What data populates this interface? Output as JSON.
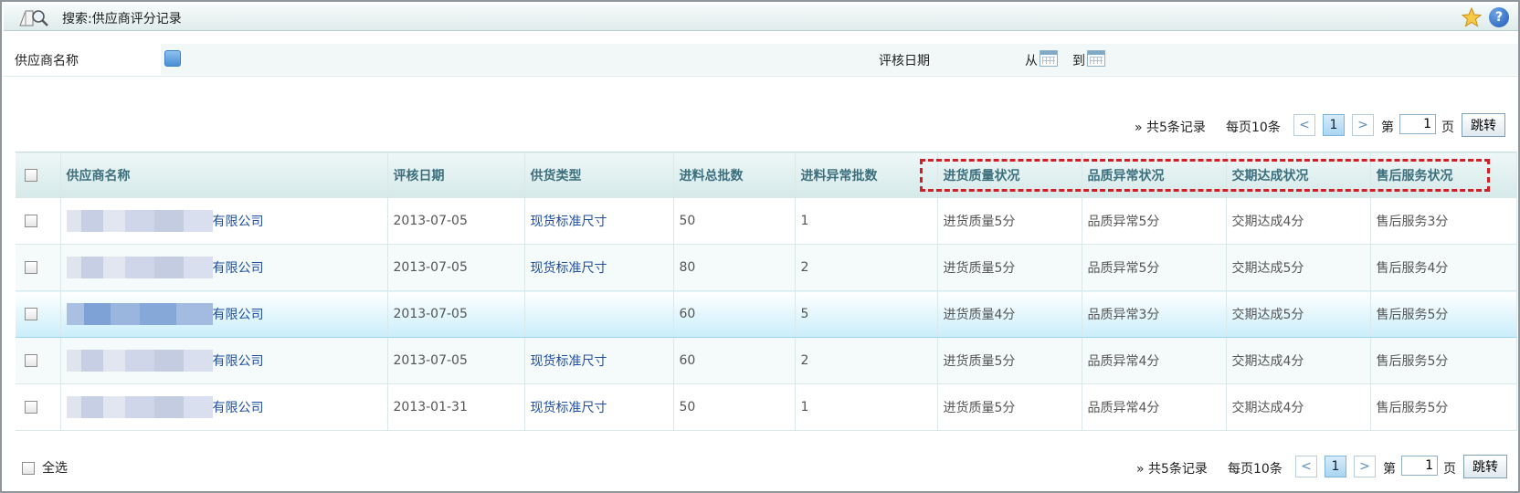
{
  "header": {
    "title": "搜索:供应商评分记录",
    "icons": [
      "search-doc-icon",
      "star-icon",
      "help-icon"
    ],
    "help_glyph": "?"
  },
  "search": {
    "supplier_label": "供应商名称",
    "supplier_value": "",
    "date_label": "评核日期",
    "from_label": "从",
    "to_label": "到"
  },
  "pager": {
    "total_text": "» 共5条记录",
    "per_page_text": "每页10条",
    "prev": "<",
    "next": ">",
    "current_page": "1",
    "page_prefix": "第",
    "page_suffix": "页",
    "page_input": "1",
    "jump_label": "跳转"
  },
  "table": {
    "columns": [
      "供应商名称",
      "评核日期",
      "供货类型",
      "进料总批数",
      "进料异常批数",
      "进货质量状况",
      "品质异常状况",
      "交期达成状况",
      "售后服务状况"
    ],
    "rows": [
      {
        "company_suffix": "有限公司",
        "date": "2013-07-05",
        "supply_type": "现货标准尺寸",
        "total": "50",
        "abnormal": "1",
        "quality": "进货质量5分",
        "defect": "品质异常5分",
        "delivery": "交期达成4分",
        "service": "售后服务3分"
      },
      {
        "company_suffix": "有限公司",
        "date": "2013-07-05",
        "supply_type": "现货标准尺寸",
        "total": "80",
        "abnormal": "2",
        "quality": "进货质量5分",
        "defect": "品质异常5分",
        "delivery": "交期达成5分",
        "service": "售后服务4分"
      },
      {
        "company_suffix": "有限公司",
        "date": "2013-07-05",
        "supply_type": "",
        "total": "60",
        "abnormal": "5",
        "quality": "进货质量4分",
        "defect": "品质异常3分",
        "delivery": "交期达成5分",
        "service": "售后服务5分"
      },
      {
        "company_suffix": "有限公司",
        "date": "2013-07-05",
        "supply_type": "现货标准尺寸",
        "total": "60",
        "abnormal": "2",
        "quality": "进货质量5分",
        "defect": "品质异常4分",
        "delivery": "交期达成4分",
        "service": "售后服务5分"
      },
      {
        "company_suffix": "有限公司",
        "date": "2013-01-31",
        "supply_type": "现货标准尺寸",
        "total": "50",
        "abnormal": "1",
        "quality": "进货质量5分",
        "defect": "品质异常4分",
        "delivery": "交期达成4分",
        "service": "售后服务5分"
      }
    ]
  },
  "footer": {
    "select_all_label": "全选"
  },
  "colors": {
    "accent": "#1f4fa0",
    "header_text": "#3c6f7d",
    "highlight_box": "#d51d26"
  }
}
